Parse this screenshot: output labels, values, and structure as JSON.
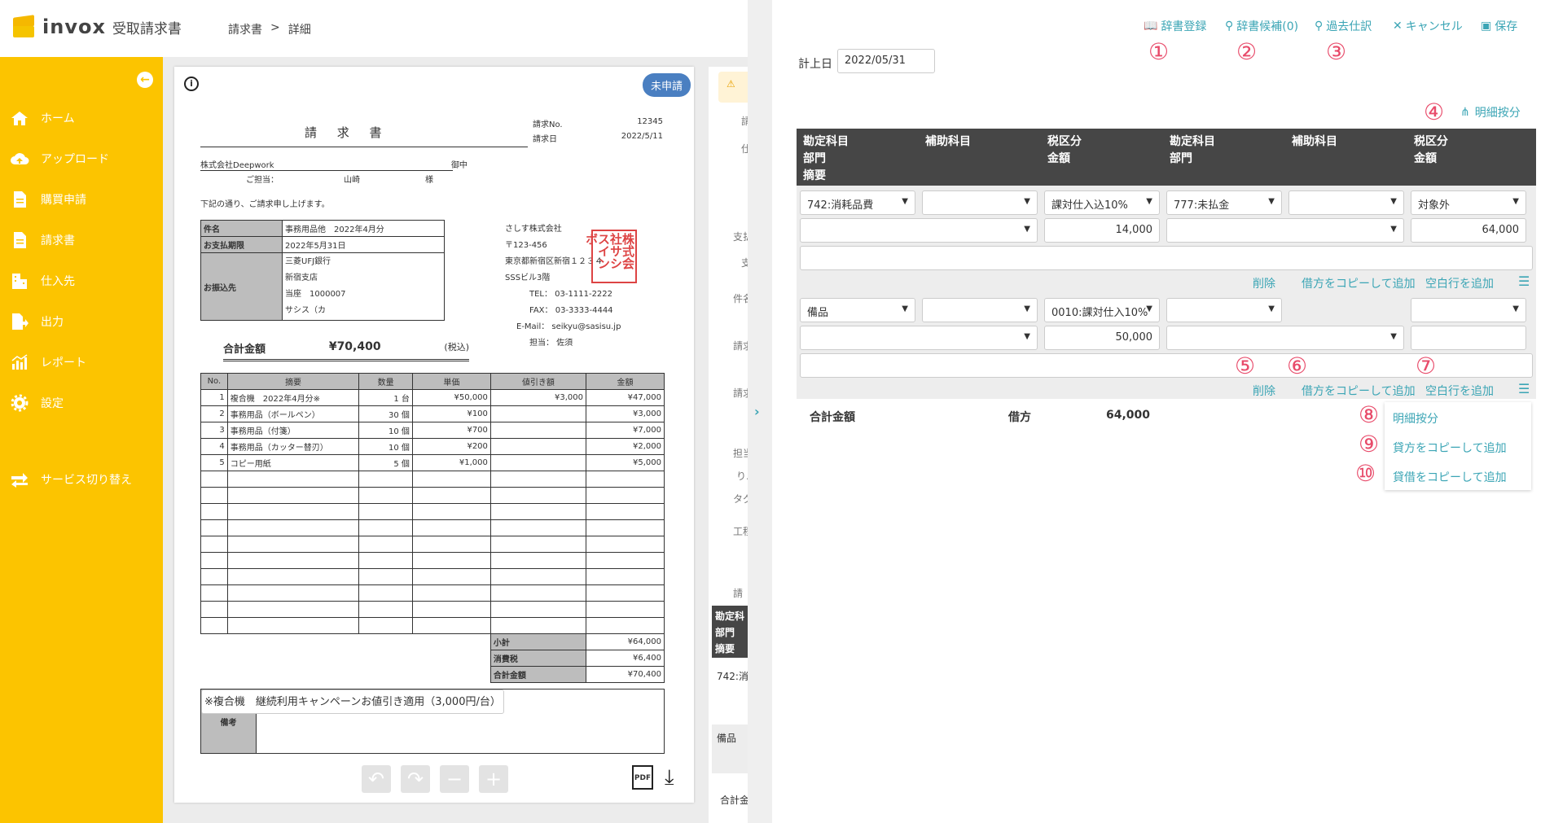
{
  "app": {
    "logo": "invox",
    "logo_sub": "受取請求書",
    "breadcrumb": [
      "請求書",
      ">",
      "詳細"
    ]
  },
  "sidebar": {
    "collapse_icon": "arrow-left-circle-icon",
    "items": [
      {
        "label": "ホーム",
        "icon": "home-icon"
      },
      {
        "label": "アップロード",
        "icon": "cloud-upload-icon"
      },
      {
        "label": "購買申請",
        "icon": "document-icon"
      },
      {
        "label": "請求書",
        "icon": "document-icon"
      },
      {
        "label": "仕入先",
        "icon": "building-icon"
      },
      {
        "label": "出力",
        "icon": "export-icon"
      },
      {
        "label": "レポート",
        "icon": "chart-icon"
      },
      {
        "label": "設定",
        "icon": "gear-icon"
      },
      {
        "label": "サービス切り替え",
        "icon": "switch-icon"
      }
    ]
  },
  "document": {
    "status_badge": "未申請",
    "title": "請 求 書",
    "no_label": "請求No.",
    "no_value": "12345",
    "date_label": "請求日",
    "date_value": "2022/5/11",
    "recipient": "株式会社Deepwork",
    "recipient_suffix": "御中",
    "contact_label": "ご担当：",
    "contact_name": "山崎",
    "contact_suffix": "様",
    "intro": "下記の通り、ご請求申し上げます。",
    "info": [
      {
        "label": "件名",
        "value": "事務用品他　2022年4月分"
      },
      {
        "label": "お支払期限",
        "value": "2022年5月31日"
      },
      {
        "label": "お振込先",
        "value": [
          "三菱UFJ銀行",
          "新宿支店",
          "当座　1000007",
          "サシス（カ"
        ]
      }
    ],
    "issuer": [
      "さしす株式会社",
      "〒123-456",
      "東京都新宿区新宿１２３４",
      "SSSビル3階",
      "TEL： 03-1111-2222",
      "FAX： 03-3333-4444",
      "E-Mail： seikyu@sasisu.jp",
      "担当： 佐須"
    ],
    "stamp": "株式会社サシスインボ",
    "total_label": "合計金額",
    "total_value": "¥70,400",
    "total_tax": "(税込)",
    "items_headers": [
      "No.",
      "摘要",
      "数量",
      "単価",
      "値引き額",
      "金額"
    ],
    "items": [
      [
        "1",
        "複合機　2022年4月分※",
        "1 台",
        "¥50,000",
        "¥3,000",
        "¥47,000"
      ],
      [
        "2",
        "事務用品（ボールペン）",
        "30 個",
        "¥100",
        "",
        "¥3,000"
      ],
      [
        "3",
        "事務用品（付箋）",
        "10 個",
        "¥700",
        "",
        "¥7,000"
      ],
      [
        "4",
        "事務用品（カッター替刃）",
        "10 個",
        "¥200",
        "",
        "¥2,000"
      ],
      [
        "5",
        "コピー用紙",
        "5 個",
        "¥1,000",
        "",
        "¥5,000"
      ]
    ],
    "summary": [
      {
        "label": "小計",
        "value": "¥64,000"
      },
      {
        "label": "消費税",
        "value": "¥6,400"
      },
      {
        "label": "合計金額",
        "value": "¥70,400"
      }
    ],
    "remarks_label": "備考",
    "remarks": "※複合機　継続利用キャンペーンお値引き適用（3,000円/台）",
    "pdf_label": "PDF"
  },
  "mid_panel": {
    "texts": [
      "請",
      "仕",
      "支払",
      "支",
      "件名",
      "請求",
      "請求",
      "担当",
      "り.",
      "タグ",
      "工程",
      "請",
      "勘定科",
      "部門",
      "摘要",
      "742:消",
      "備品",
      "合計金"
    ]
  },
  "journal": {
    "toolbar": [
      {
        "label": "辞書登録",
        "icon": "book-icon",
        "marker": "①"
      },
      {
        "label": "辞書候補(0)",
        "icon": "search-icon",
        "marker": "②"
      },
      {
        "label": "過去仕訳",
        "icon": "search-icon",
        "marker": "③"
      },
      {
        "label": "キャンセル",
        "icon": "close-icon"
      },
      {
        "label": "保存",
        "icon": "save-icon"
      }
    ],
    "date_label": "計上日",
    "date_value": "2022/05/31",
    "split_label": "明細按分",
    "split_marker": "④",
    "headers": {
      "debit_account": "勘定科目",
      "debit_dept": "部門",
      "summary": "摘要",
      "debit_sub": "補助科目",
      "debit_tax": "税区分",
      "debit_amount": "金額",
      "credit_account": "勘定科目",
      "credit_dept": "部門",
      "credit_sub": "補助科目",
      "credit_tax": "税区分",
      "credit_amount": "金額"
    },
    "rows": [
      {
        "debit_account": "742:消耗品費",
        "debit_sub": "",
        "debit_tax": "課対仕入込10%",
        "credit_account": "777:未払金",
        "credit_sub": "",
        "credit_tax": "対象外",
        "debit_amount": "14,000",
        "credit_amount": "64,000"
      },
      {
        "debit_account": "備品",
        "debit_sub": "",
        "debit_tax": "0010:課対仕入10%",
        "credit_account": "",
        "credit_tax": "",
        "debit_amount": "50,000",
        "credit_amount": ""
      }
    ],
    "row_actions": {
      "delete": "削除",
      "copy_debit": "借方をコピーして追加",
      "add_blank": "空白行を追加"
    },
    "markers": {
      "delete": "⑤",
      "copy_debit": "⑥",
      "add_blank": "⑦"
    },
    "totals": {
      "label": "合計金額",
      "side": "借方",
      "value": "64,000"
    },
    "menu": [
      {
        "label": "明細按分",
        "marker": "⑧"
      },
      {
        "label": "貸方をコピーして追加",
        "marker": "⑨"
      },
      {
        "label": "貸借をコピーして追加",
        "marker": "⑩"
      }
    ]
  }
}
